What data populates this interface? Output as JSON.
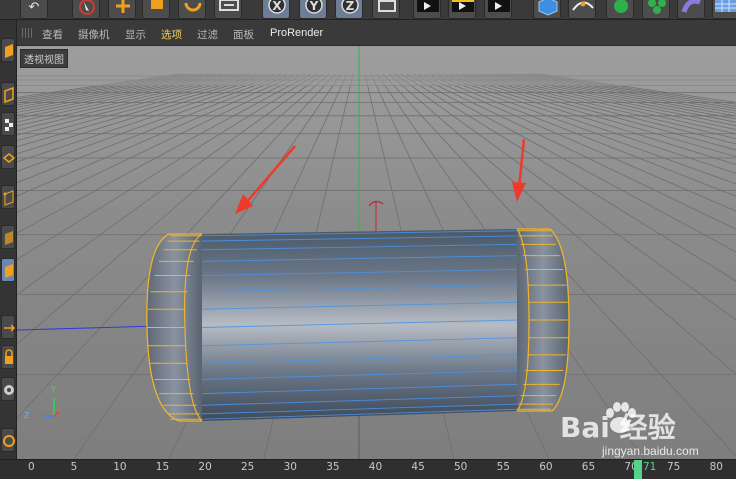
{
  "toolbar": {
    "buttons": [
      {
        "icon": "undo-icon",
        "active": false
      },
      {
        "icon": "select-arrow-icon",
        "active": false
      },
      {
        "icon": "move-icon",
        "active": false
      },
      {
        "icon": "scale-icon",
        "active": false
      },
      {
        "icon": "rotate-icon",
        "active": false
      },
      {
        "icon": "recent-tool-icon",
        "active": false
      },
      {
        "icon": "x-axis-lock-icon",
        "active": true,
        "glyph": "X"
      },
      {
        "icon": "y-axis-lock-icon",
        "active": true,
        "glyph": "Y"
      },
      {
        "icon": "z-axis-lock-icon",
        "active": true,
        "glyph": "Z"
      },
      {
        "icon": "coordinate-system-icon",
        "active": false
      },
      {
        "icon": "render-view-icon",
        "active": false
      },
      {
        "icon": "render-picture-viewer-icon",
        "active": false
      },
      {
        "icon": "render-settings-icon",
        "active": false
      },
      {
        "icon": "cube-icon",
        "active": false
      },
      {
        "icon": "spline-pen-icon",
        "active": false
      },
      {
        "icon": "subdivision-icon",
        "active": false
      },
      {
        "icon": "cloner-icon",
        "active": false
      },
      {
        "icon": "deformer-icon",
        "active": false
      },
      {
        "icon": "floor-icon",
        "active": false
      }
    ]
  },
  "menu": {
    "items": [
      "查看",
      "摄像机",
      "显示",
      "选项",
      "过滤",
      "面板",
      "ProRender"
    ],
    "active_index": 3
  },
  "viewport": {
    "label": "透视视图",
    "object": "cylinder",
    "highlight_color": "#f0b428",
    "arrow_color": "#ee3a2a",
    "axis_labels": {
      "x": "",
      "y": "Y",
      "z": "Z"
    }
  },
  "timeline": {
    "ticks": [
      "0",
      "5",
      "10",
      "15",
      "20",
      "25",
      "30",
      "35",
      "40",
      "45",
      "50",
      "55",
      "60",
      "65",
      "70",
      "75",
      "80"
    ],
    "current_frame": "71"
  },
  "watermark": {
    "brand": "Bai  经验",
    "url": "jingyan.baidu.com"
  }
}
